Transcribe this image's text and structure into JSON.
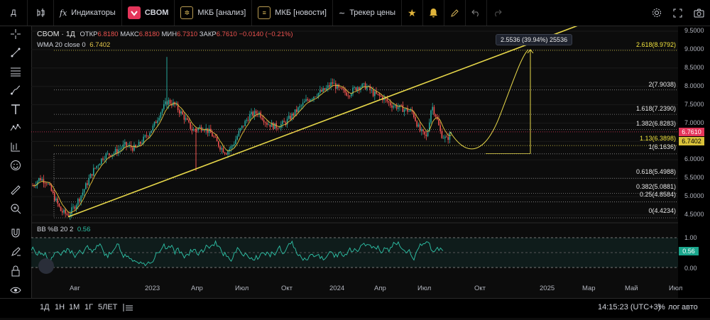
{
  "toolbar": {
    "symbol_search": "Д",
    "indicators": "Индикаторы",
    "symbol": "CBOM",
    "mkb_analysis": "МКБ [анализ]",
    "mkb_news": "МКБ [новости]",
    "price_tracker": "Трекер цены"
  },
  "legend": {
    "title": "CBOM · 1Д",
    "open_label": "ОТКР",
    "open": "6.8180",
    "high_label": "МАКС",
    "high": "6.8180",
    "low_label": "МИН",
    "low": "6.7310",
    "close_label": "ЗАКР",
    "close": "6.7610",
    "change": "−0.0140 (−0.21%)",
    "wma_label": "WMA 20 close 0",
    "wma_value": "6.7402"
  },
  "price_axis": {
    "ticks": [
      "9.5000",
      "9.0000",
      "8.5000",
      "8.0000",
      "7.5000",
      "7.0000",
      "6.5000",
      "6.0000",
      "5.5000",
      "5.0000",
      "4.5000"
    ],
    "last_price": "6.7610",
    "wma_price": "6.7402"
  },
  "fib_levels": [
    "2.618(8.9792)",
    "2(7.9038)",
    "1.618(7.2390)",
    "1.382(6.8283)",
    "1.13(6.3898)",
    "1(6.1636)",
    "0.618(5.4988)",
    "0.382(5.0881)",
    "0.25(4.8584)",
    "0(4.4234)"
  ],
  "measure_label": "2.5536 (39.94%) 25536",
  "oscillator": {
    "label": "BB %B 20 2",
    "value": "0.56",
    "ticks": [
      "1.00",
      "0.50",
      "0.00"
    ],
    "current": "0.56"
  },
  "time_axis": [
    "Авг",
    "2023",
    "Апр",
    "Июл",
    "Окт",
    "2024",
    "Апр",
    "Июл",
    "Окт",
    "2025",
    "Мар",
    "Май",
    "Июл"
  ],
  "bottom": {
    "ranges": [
      "1Д",
      "1Н",
      "1М",
      "1Г",
      "5ЛЕТ"
    ],
    "clock": "14:15:23 (UTC+3)",
    "percent": "%",
    "log": "лог",
    "auto": "авто"
  },
  "colors": {
    "up": "#26a69a",
    "down": "#ef5350",
    "fib_line": "#e8d84a",
    "wma": "#d4b53a",
    "osc": "#2ec4a9",
    "last_price_bg": "#e4355a",
    "wma_bg": "#d9c23a"
  },
  "icons": [
    "crosshair-icon",
    "trend-line-icon",
    "fib-icon",
    "brush-icon",
    "text-icon",
    "pattern-icon",
    "forecast-icon",
    "emoji-icon",
    "ruler-icon",
    "zoom-icon",
    "magnet-icon",
    "lock-draw-icon",
    "lock-icon",
    "eye-icon",
    "trash-icon"
  ]
}
